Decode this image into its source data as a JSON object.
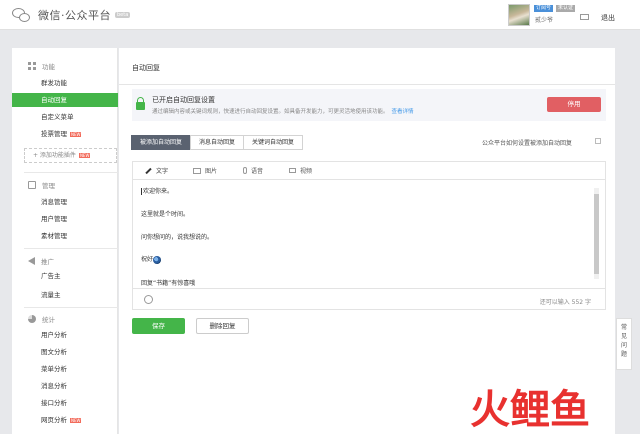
{
  "header": {
    "logo_text": "微信·公众平台",
    "beta": "beta",
    "account_type": "订阅号",
    "unverified": "未认证",
    "username": "贰少爷",
    "logout": "退出"
  },
  "sidebar": {
    "sections": [
      {
        "title": "功能",
        "icon": "grid-icon",
        "items": [
          "群发功能",
          "自动回复",
          "自定义菜单",
          "投票管理"
        ],
        "new_tag": "NEW"
      },
      {
        "title": "管理",
        "icon": "box-icon",
        "items": [
          "消息管理",
          "用户管理",
          "素材管理"
        ]
      },
      {
        "title": "推广",
        "icon": "speaker-icon",
        "items": [
          "广告主",
          "流量主"
        ]
      },
      {
        "title": "统计",
        "icon": "pie-icon",
        "items": [
          "用户分析",
          "图文分析",
          "菜单分析",
          "消息分析",
          "接口分析",
          "网页分析"
        ]
      }
    ],
    "add_plugin": "+ 添加功能插件",
    "active_item": "自动回复"
  },
  "main": {
    "title": "自动回复",
    "notice_title": "已开启自动回复设置",
    "notice_desc": "通过编辑内容或关键词规则，快速进行自动回复设置。如具备开发能力，可更灵活地使用该功能。",
    "notice_link": "查看详情",
    "disable_button": "停用",
    "tabs": [
      "被添加自动回复",
      "消息自动回复",
      "关键词自动回复"
    ],
    "how_to": "公众平台如何设置被添加自动回复",
    "editor_tabs": [
      "文字",
      "图片",
      "语音",
      "视频"
    ],
    "lines": [
      "欢迎你来。",
      "这里就是个时间。",
      "问你想问的，说我想说的。",
      "祝好",
      "回复“书籍”有惊喜哦"
    ],
    "char_count": "还可以输入 552 字",
    "save_button": "保存",
    "delete_button": "删除回复",
    "faq": "常见问题"
  },
  "watermark": {
    "text": "火鲤鱼"
  }
}
